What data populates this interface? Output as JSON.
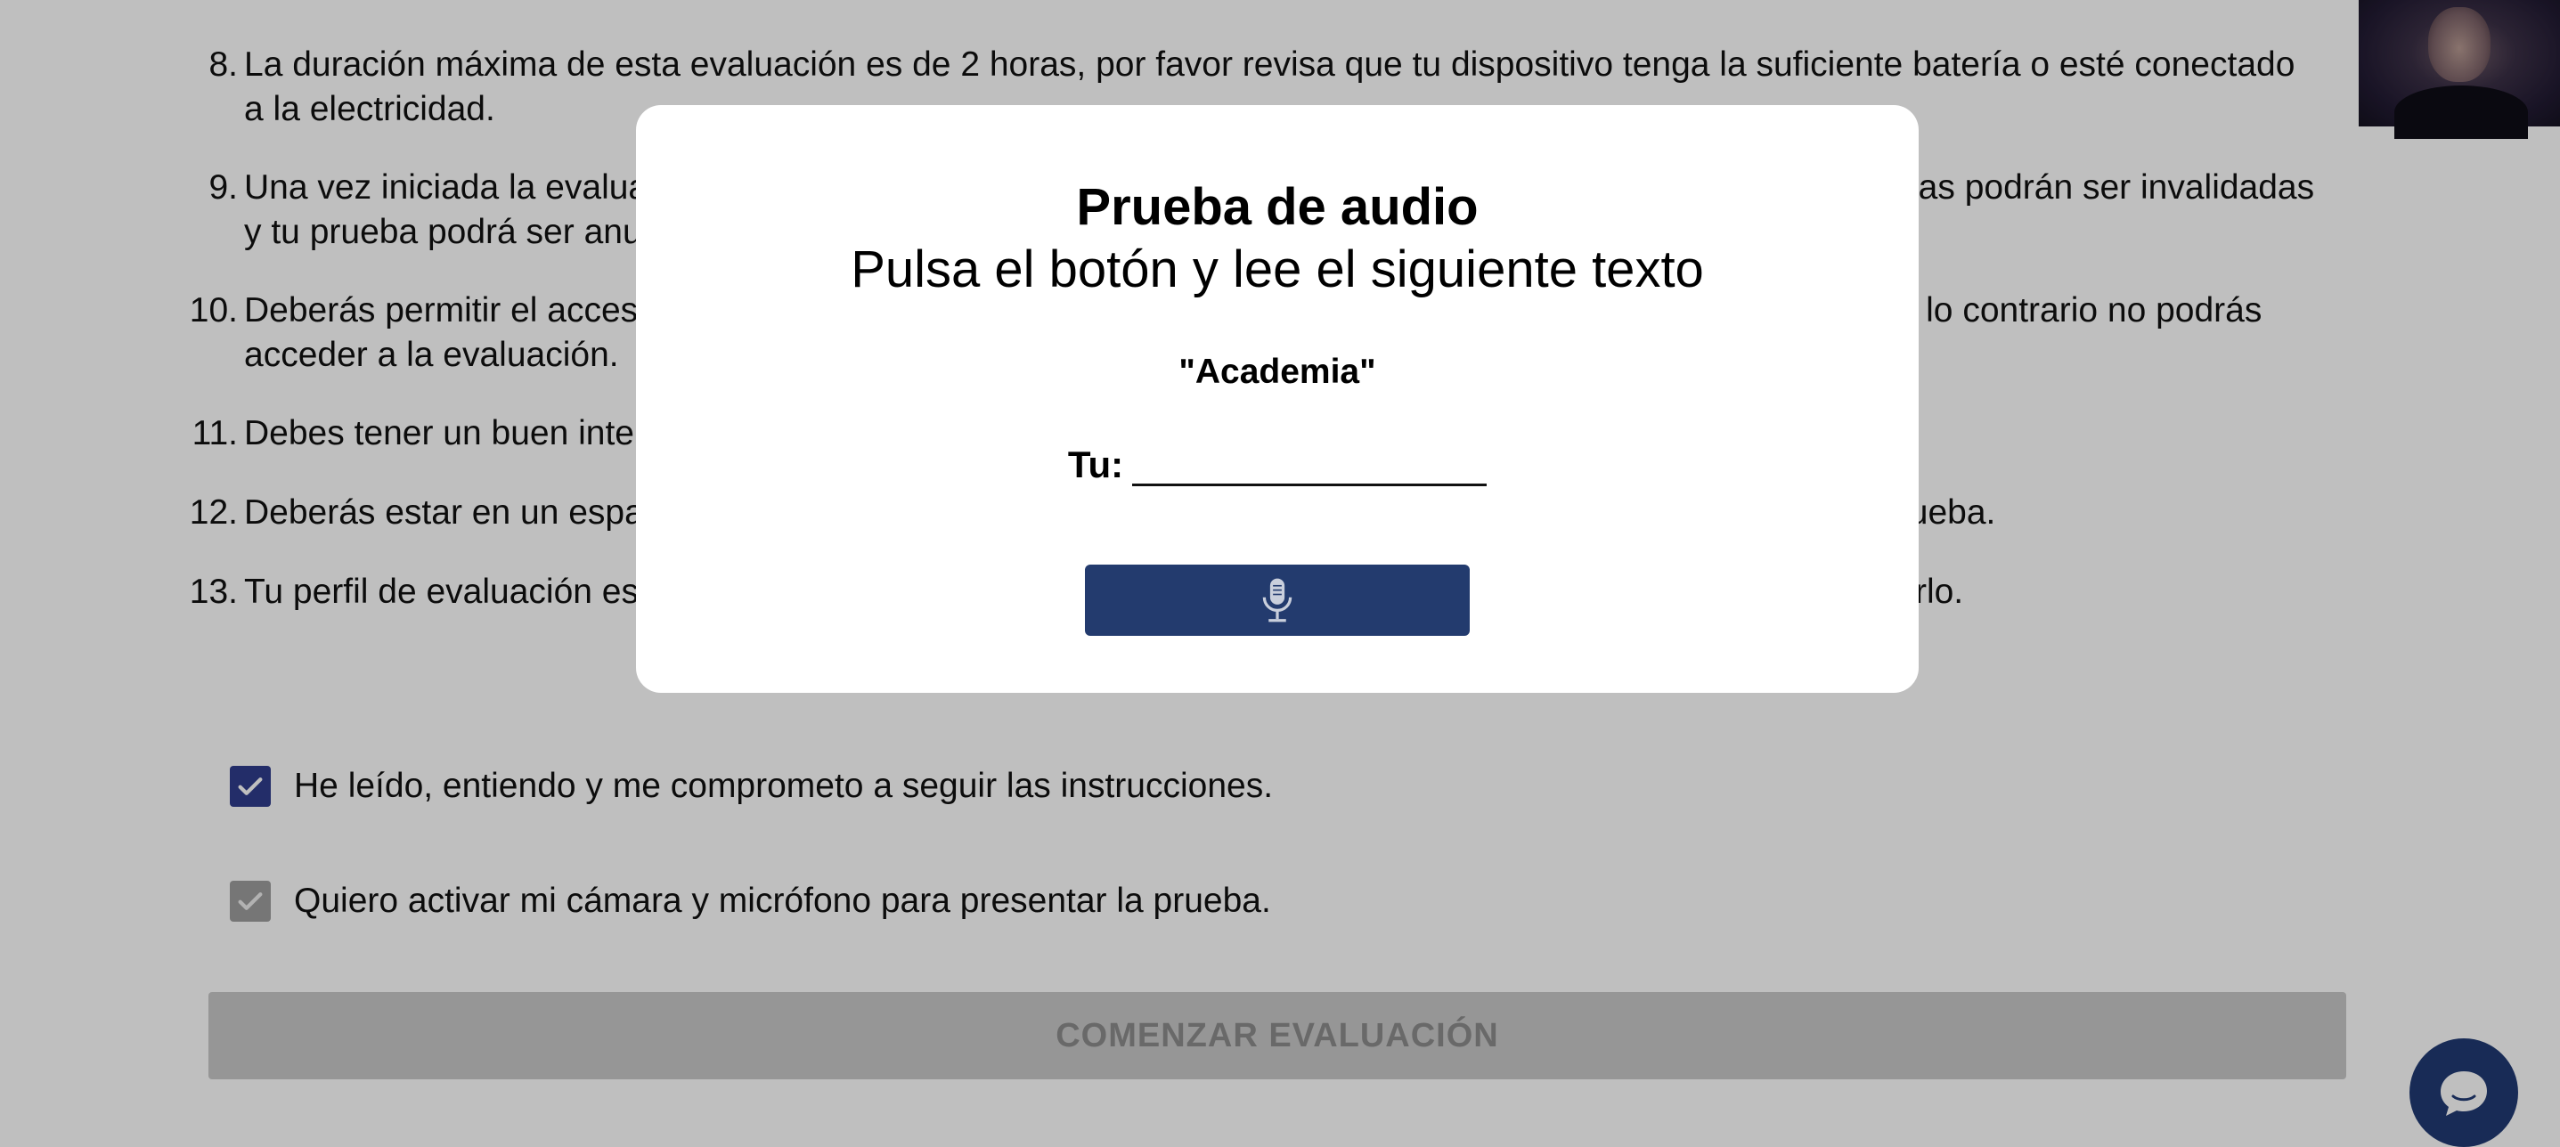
{
  "instructions": [
    {
      "num": "8.",
      "text": "La duración máxima de esta evaluación es de 2 horas, por favor revisa que tu dispositivo tenga la suficiente batería o esté conectado a la electricidad."
    },
    {
      "num": "9.",
      "text": "Una vez iniciada la evaluación no podrás salir de la pantalla, si sales de la pantalla de la prueba tus respuestas podrán ser invalidadas y tu prueba podrá ser anulada."
    },
    {
      "num": "10.",
      "text": "Deberás permitir el acceso a tu cámara y micrófono durante el transcurso de la prueba para el monitoreo, de lo contrario no podrás acceder a la evaluación."
    },
    {
      "num": "11.",
      "text": "Debes tener un buen internet para que tus respuestas se guarden correctamente en los tiempos."
    },
    {
      "num": "12.",
      "text": "Deberás estar en un espacio silencioso y sin compañía, cualquier irregularidad detectada pueda anular la prueba."
    },
    {
      "num": "13.",
      "text": "Tu perfil de evaluación es necesario que revises tus datos personales antes de comenzar para poder corregirlo."
    }
  ],
  "checkboxes": {
    "instructions_label": "He leído, entiendo y me comprometo a seguir las instrucciones.",
    "camera_label": "Quiero activar mi cámara y micrófono para presentar la prueba."
  },
  "start_button_label": "COMENZAR EVALUACIÓN",
  "modal": {
    "title": "Prueba de audio",
    "subtitle": "Pulsa el botón y lee el siguiente texto",
    "word": "\"Academia\"",
    "answer_label": "Tu:",
    "record_button_icon": "microphone-icon"
  },
  "colors": {
    "accent": "#2f3d8c",
    "mic_button": "#233b6e",
    "chat_button": "#213a73"
  }
}
